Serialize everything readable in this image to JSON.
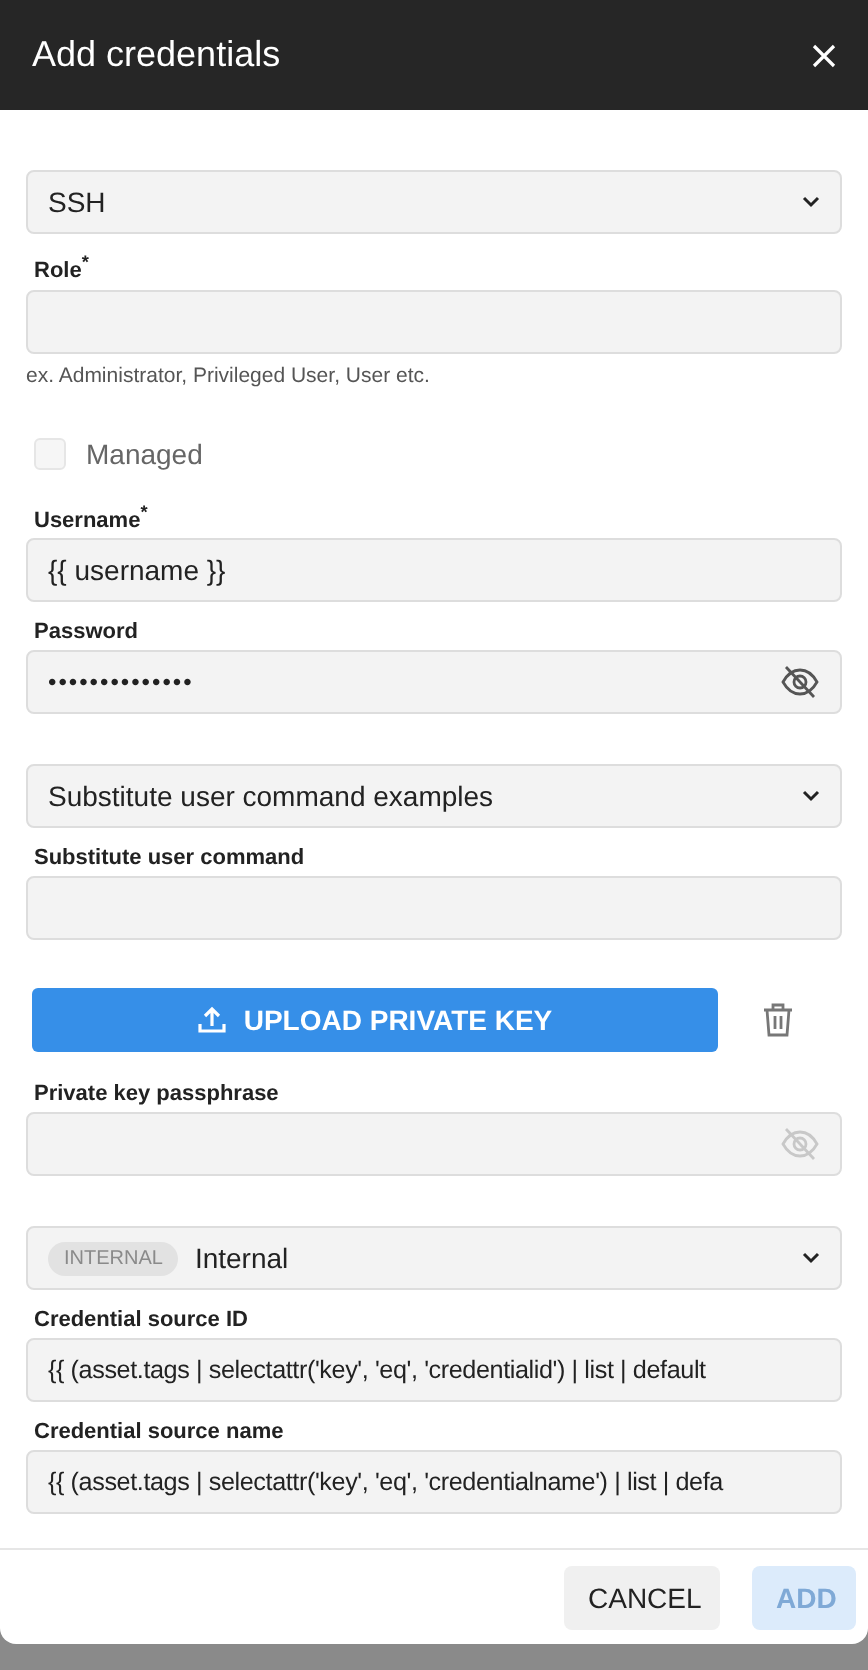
{
  "dialog": {
    "title": "Add credentials"
  },
  "form": [
    {
      "kind": "select",
      "value": "SSH"
    },
    {
      "kind": "text",
      "label": "Role$^{*}$",
      "hint": "ex. Administrator, Privileged User, User etc."
    },
    {
      "kind": "checkbox",
      "label": "Managed",
      "checked": false,
      "disabled": true
    },
    {
      "kind": "text",
      "label": "Username$^{*}$",
      "value": "{{ username }}"
    },
    {
      "kind": "password",
      "label": "Password",
      "value": "••••••••••••••",
      "disabled": false
    },
    {
      "kind": "select",
      "value": "Substitute user command examples"
    },
    {
      "kind": "text",
      "label": "Substitute user command"
    },
    {
      "kind": "upload",
      "button": "UPLOAD PRIVATE KEY"
    },
    {
      "kind": "password",
      "label": "Private key passphrase",
      "disabled": true
    },
    {
      "kind": "source",
      "badge": "INTERNAL",
      "value": "Internal"
    },
    {
      "kind": "text",
      "label": "Credential source ID",
      "value": "{{ (asset.tags | selectattr('key', 'eq', 'credentialid') | list | default"
    },
    {
      "kind": "text",
      "label": "Credential source name",
      "value": "{{ (asset.tags | selectattr('key', 'eq', 'credentialname') | list | defa"
    }
  ],
  "footer": {
    "buttons": [
      {
        "label": "CANCEL",
        "kind": "secondary",
        "disabled": false
      },
      {
        "label": "ADD",
        "kind": "primary",
        "disabled": true
      }
    ]
  }
}
